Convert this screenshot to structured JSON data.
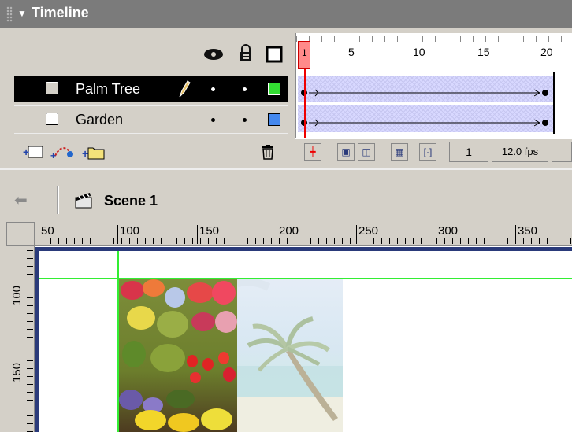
{
  "timeline": {
    "title": "Timeline",
    "header_icons": [
      "eye-icon",
      "lock-icon",
      "outline-icon"
    ],
    "frame_numbers": [
      "5",
      "10",
      "15",
      "20"
    ],
    "playhead_frame": "1",
    "layers": [
      {
        "name": "Palm Tree",
        "selected": true,
        "color": "#33dd33",
        "editing": true
      },
      {
        "name": "Garden",
        "selected": false,
        "color": "#4488ee",
        "editing": false
      }
    ],
    "tool_icons": [
      "insert-layer-icon",
      "add-guide-layer-icon",
      "insert-folder-icon",
      "delete-layer-icon"
    ],
    "controls": {
      "current_frame": "1",
      "frame_rate": "12.0 fps",
      "control_icons": [
        "center-frame-icon",
        "onion-skin-icon",
        "onion-skin-outlines-icon",
        "edit-multiple-frames-icon",
        "modify-onion-markers-icon"
      ]
    }
  },
  "editbar": {
    "scene_label": "Scene 1"
  },
  "rulers": {
    "horizontal": [
      "50",
      "100",
      "150",
      "200",
      "250",
      "300",
      "350"
    ],
    "vertical": [
      "100",
      "150"
    ]
  },
  "colors": {
    "panel": "#d4d0c8",
    "title_bar": "#7b7b7b",
    "selection": "#000000",
    "guide": "#33ee33",
    "playhead": "#ff0000"
  }
}
